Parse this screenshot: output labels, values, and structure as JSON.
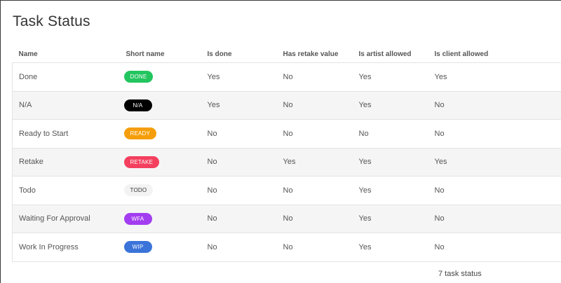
{
  "page": {
    "title": "Task Status"
  },
  "table": {
    "columns": [
      "Name",
      "Short name",
      "Is done",
      "Has retake value",
      "Is artist allowed",
      "Is client allowed"
    ],
    "rows": [
      {
        "name": "Done",
        "short_name": "DONE",
        "badge_bg": "#22c55e",
        "badge_fg": "#ffffff",
        "is_done": "Yes",
        "has_retake": "No",
        "artist_allowed": "Yes",
        "client_allowed": "Yes"
      },
      {
        "name": "N/A",
        "short_name": "N/A",
        "badge_bg": "#000000",
        "badge_fg": "#ffffff",
        "is_done": "Yes",
        "has_retake": "No",
        "artist_allowed": "Yes",
        "client_allowed": "No"
      },
      {
        "name": "Ready to Start",
        "short_name": "READY",
        "badge_bg": "#f59e0b",
        "badge_fg": "#ffffff",
        "is_done": "No",
        "has_retake": "No",
        "artist_allowed": "No",
        "client_allowed": "No"
      },
      {
        "name": "Retake",
        "short_name": "RETAKE",
        "badge_bg": "#f43f5e",
        "badge_fg": "#ffffff",
        "is_done": "No",
        "has_retake": "Yes",
        "artist_allowed": "Yes",
        "client_allowed": "Yes"
      },
      {
        "name": "Todo",
        "short_name": "TODO",
        "badge_bg": "#f3f3f3",
        "badge_fg": "#333333",
        "is_done": "No",
        "has_retake": "No",
        "artist_allowed": "Yes",
        "client_allowed": "No"
      },
      {
        "name": "Waiting For Approval",
        "short_name": "WFA",
        "badge_bg": "#a33df0",
        "badge_fg": "#ffffff",
        "is_done": "No",
        "has_retake": "No",
        "artist_allowed": "Yes",
        "client_allowed": "No"
      },
      {
        "name": "Work In Progress",
        "short_name": "WIP",
        "badge_bg": "#3b74d9",
        "badge_fg": "#ffffff",
        "is_done": "No",
        "has_retake": "No",
        "artist_allowed": "Yes",
        "client_allowed": "No"
      }
    ]
  },
  "footer": {
    "count_text": "7 task status"
  }
}
